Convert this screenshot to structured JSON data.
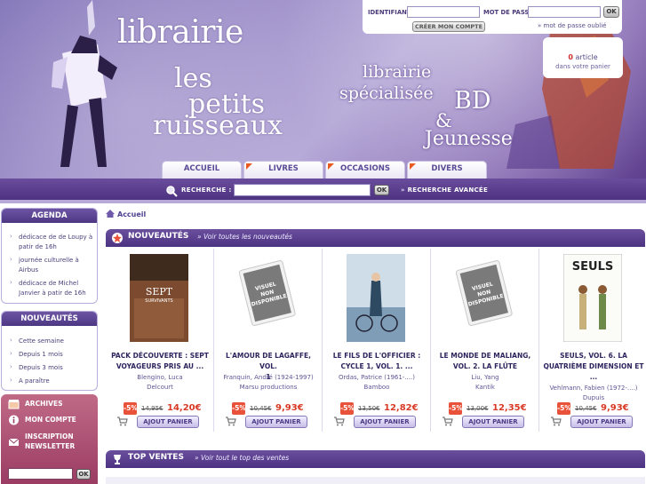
{
  "header": {
    "logo_line1": "librairie",
    "logo_line2": "les",
    "logo_line3": "petits",
    "logo_line4": "ruisseaux",
    "tag_line1": "librairie",
    "tag_line2": "spécialisée",
    "tag_bd": "BD",
    "tag_amp": "&",
    "tag_jeunesse": "Jeunesse"
  },
  "login": {
    "identifiant_label": "IDENTIFIANT",
    "password_label": "MOT DE PASSE",
    "ok_label": "OK",
    "create_account_label": "CRÉER MON COMPTE",
    "forgot_label": "mot de passe oublié"
  },
  "cart": {
    "count": "0",
    "count_suffix": "article",
    "sub": "dans votre panier"
  },
  "nav": {
    "tabs": [
      "ACCUEIL",
      "LIVRES",
      "OCCASIONS",
      "DIVERS"
    ]
  },
  "search": {
    "label": "RECHERCHE :",
    "ok_label": "OK",
    "advanced_label": "RECHERCHE AVANCÉE"
  },
  "sidebar": {
    "agenda_title": "AGENDA",
    "agenda_items": [
      "dédicace de de Loupy à patir de 16h",
      "journée culturelle à Airbus",
      "dédicace de Michel Janvier à patir de 16h"
    ],
    "nouveautes_title": "NOUVEAUTÉS",
    "nouveautes_items": [
      "Cette semaine",
      "Depuis 1 mois",
      "Depuis 3 mois",
      "A paraître"
    ],
    "archives_label": "ARCHIVES",
    "account_label": "MON COMPTE",
    "newsletter_label_1": "INSCRIPTION",
    "newsletter_label_2": "NEWSLETTER",
    "newsletter_ok": "OK"
  },
  "main": {
    "breadcrumb": "Accueil",
    "new_title": "NOUVEAUTÉS",
    "new_link": "» Voir toutes les nouveautés",
    "top_title": "TOP VENTES",
    "top_link": "» Voir tout le top des ventes",
    "add_label": "AJOUT PANIER",
    "unavailable_line1": "VISUEL",
    "unavailable_line2": "NON",
    "unavailable_line3": "DISPONIBLE",
    "cover_sept_line1": "SEPT",
    "cover_sept_line2": "SURVIVANTS",
    "cover_seuls": "SEULS",
    "products": [
      {
        "title": "PACK DÉCOUVERTE : SEPT VOYAGEURS PRIS AU ...",
        "title_line1": "PACK DÉCOUVERTE : SEPT",
        "title_line2": "VOYAGEURS PRIS AU ...",
        "author": "Blengino, Luca",
        "publisher": "Delcourt",
        "discount": "-5%",
        "old_price": "14,95€",
        "price": "14,20€"
      },
      {
        "title": "L'AMOUR DE LAGAFFE, VOL. 1",
        "title_line1": "L'AMOUR DE LAGAFFE, VOL.",
        "title_line2": "1",
        "author": "Franquin, André (1924-1997)",
        "publisher": "Marsu productions",
        "discount": "-5%",
        "old_price": "10,45€",
        "price": "9,93€"
      },
      {
        "title": "LE FILS DE L'OFFICIER : CYCLE 1, VOL. 1. ...",
        "title_line1": "LE FILS DE L'OFFICIER :",
        "title_line2": "CYCLE 1, VOL. 1. ...",
        "author": "Ordas, Patrice (1961-....)",
        "publisher": "Bamboo",
        "discount": "-5%",
        "old_price": "13,50€",
        "price": "12,82€"
      },
      {
        "title": "LE MONDE DE MALIANG, VOL. 2. LA FLÛTE",
        "title_line1": "LE MONDE DE MALIANG,",
        "title_line2": "VOL. 2. LA FLÛTE",
        "author": "Liu, Yang",
        "publisher": "Kantik",
        "discount": "-5%",
        "old_price": "13,00€",
        "price": "12,35€"
      },
      {
        "title": "SEULS, VOL. 6. LA QUATRIÈME DIMENSION ET ...",
        "title_line1": "SEULS, VOL. 6. LA",
        "title_line2": "QUATRIÈME DIMENSION ET",
        "title_line3": "...",
        "author": "Vehlmann, Fabien (1972-....)",
        "publisher": "Dupuis",
        "discount": "-5%",
        "old_price": "10,45€",
        "price": "9,93€"
      }
    ]
  },
  "colors": {
    "brand_purple": "#5b3f91",
    "accent_red": "#d83a25"
  }
}
